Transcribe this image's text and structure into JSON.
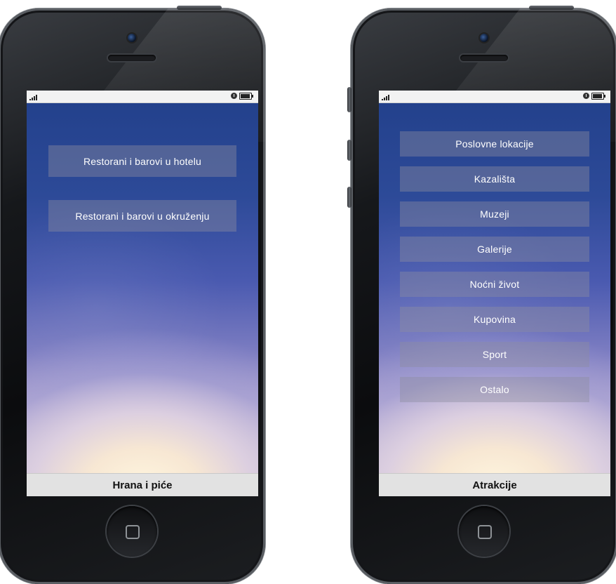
{
  "phones": [
    {
      "menu_items": [
        "Restorani i barovi u hotelu",
        "Restorani i barovi u okruženju"
      ],
      "footer_title": "Hrana i piće"
    },
    {
      "menu_items": [
        "Poslovne lokacije",
        "Kazališta",
        "Muzeji",
        "Galerije",
        "Noćni život",
        "Kupovina",
        "Sport",
        "Ostalo"
      ],
      "footer_title": "Atrakcije"
    }
  ],
  "icons": [
    "camera-icon",
    "speaker-grille-icon",
    "signal-bars-icon",
    "alarm-icon",
    "battery-icon",
    "home-button-icon"
  ]
}
